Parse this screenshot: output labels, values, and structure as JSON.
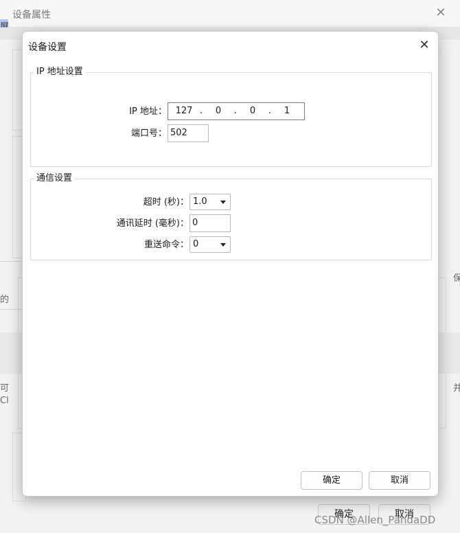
{
  "background_window": {
    "title": "设备属性",
    "left_tab_fragment": "屏",
    "fragments": {
      "left_1": "的",
      "left_2": "可",
      "left_3": "Cl",
      "right_1": "保",
      "right_2": "并"
    },
    "ok_label": "确定",
    "cancel_label": "取消"
  },
  "dialog": {
    "title": "设备设置",
    "ip_group": {
      "legend": "IP 地址设置",
      "ip_label": "IP 地址：",
      "ip_octets": [
        "127",
        "0",
        "0",
        "1"
      ],
      "port_label": "端口号：",
      "port_value": "502"
    },
    "comm_group": {
      "legend": "通信设置",
      "timeout_label": "超时 (秒)：",
      "timeout_value": "1.0",
      "delay_label": "通讯延时 (毫秒)：",
      "delay_value": "0",
      "resend_label": "重送命令：",
      "resend_value": "0"
    },
    "ok_label": "确定",
    "cancel_label": "取消"
  },
  "watermark": "CSDN @Allen_PandaDD"
}
